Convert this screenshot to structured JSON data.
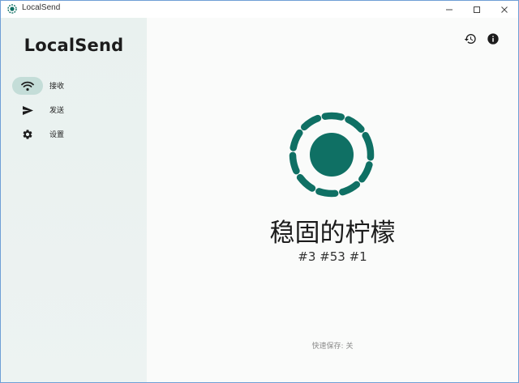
{
  "window": {
    "title": "LocalSend"
  },
  "sidebar": {
    "brand": "LocalSend",
    "items": [
      {
        "label": "接收",
        "icon": "wifi-icon",
        "selected": true
      },
      {
        "label": "发送",
        "icon": "send-icon",
        "selected": false
      },
      {
        "label": "设置",
        "icon": "gear-icon",
        "selected": false
      }
    ]
  },
  "main": {
    "device_name": "稳固的柠檬",
    "device_code": "#3 #53 #1",
    "quick_save": "快速保存: 关"
  },
  "colors": {
    "accent": "#0f7064",
    "sidebar_bg": "#e9f1ef",
    "selected_pill": "#c4ddd8"
  }
}
